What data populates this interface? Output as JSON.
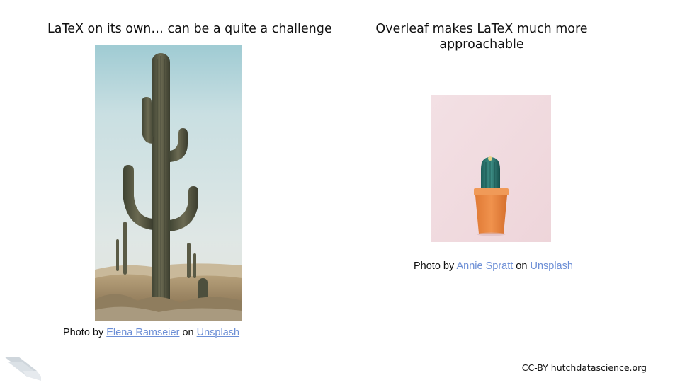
{
  "left": {
    "title": "LaTeX on its own… can be a quite  a challenge",
    "caption": {
      "prefix": "Photo by ",
      "author": "Elena Ramseier",
      "middle": " on ",
      "site": "Unsplash"
    }
  },
  "right": {
    "title": "Overleaf makes LaTeX much more approachable",
    "caption": {
      "prefix": "Photo by ",
      "author": "Annie Spratt",
      "middle": " on ",
      "site": "Unsplash"
    }
  },
  "footer": "CC-BY hutchdatascience.org",
  "colors": {
    "link": "#6d8fd6",
    "text": "#111111",
    "right_photo_background": "#f2dfe2",
    "pot": "#e8843f"
  },
  "icons": {
    "logo": "hutch-logo-icon"
  }
}
